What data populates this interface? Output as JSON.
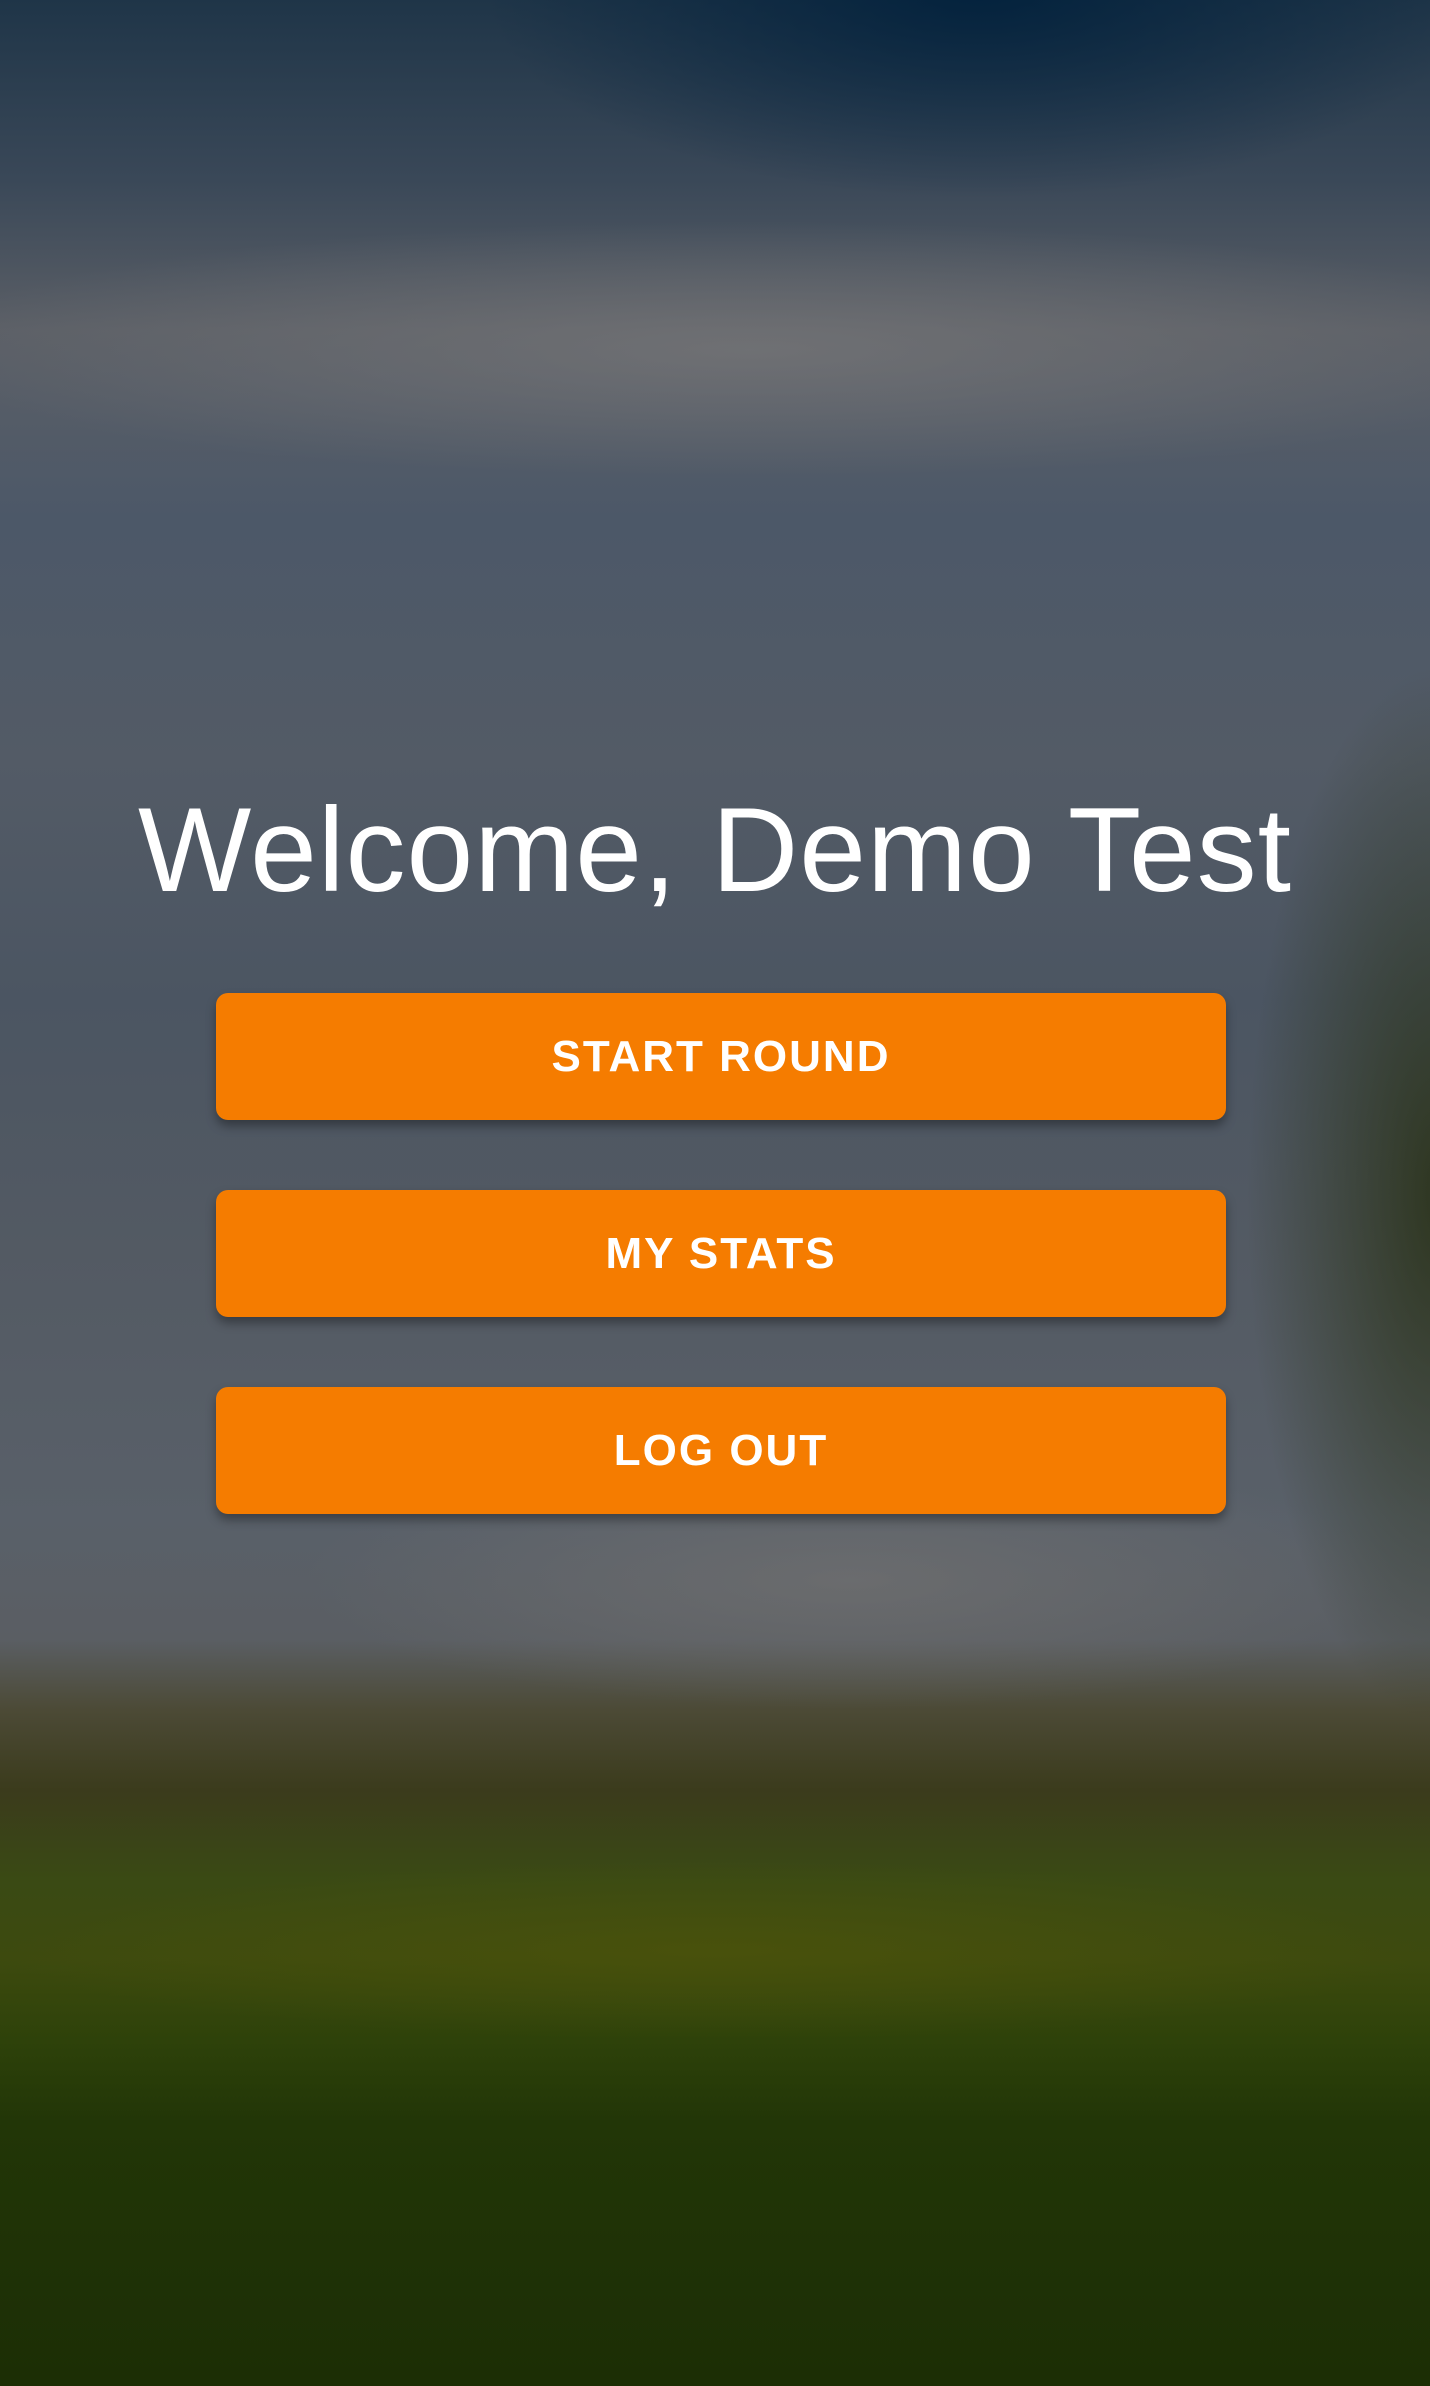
{
  "welcome": {
    "title": "Welcome, Demo Test"
  },
  "menu": {
    "start_round_label": "START ROUND",
    "my_stats_label": "MY STATS",
    "log_out_label": "LOG OUT"
  },
  "colors": {
    "button_accent": "#f57c00",
    "text": "#ffffff"
  }
}
